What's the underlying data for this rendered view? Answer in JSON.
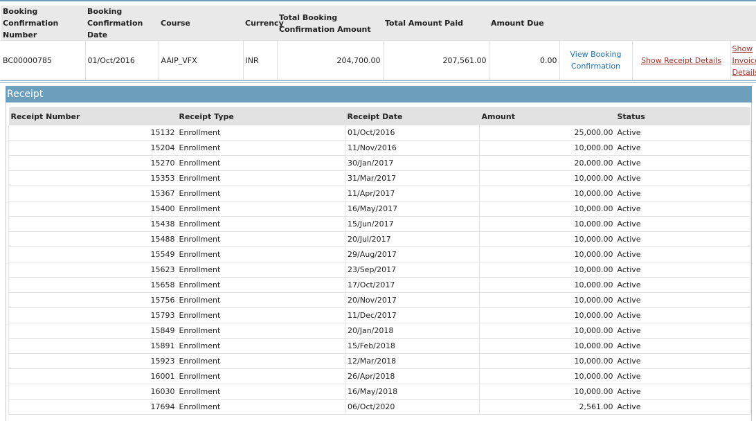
{
  "booking": {
    "headers": {
      "number": "Booking Confirmation Number",
      "date": "Booking Confirmation Date",
      "course": "Course",
      "currency": "Currency",
      "total": "Total Booking Confirmation Amount",
      "paid": "Total Amount Paid",
      "due": "Amount Due"
    },
    "row": {
      "number": "BC00000785",
      "date": "01/Oct/2016",
      "course": "AAIP_VFX",
      "currency": "INR",
      "total": "204,700.00",
      "paid": "207,561.00",
      "due": "0.00",
      "view_link": "View Booking Confirmation",
      "receipt_link": "Show Receipt Details",
      "invoice_link": "Show Invoice Details"
    }
  },
  "receipt_panel": {
    "title": "Receipt",
    "headers": {
      "number": "Receipt Number",
      "type": "Receipt Type",
      "date": "Receipt Date",
      "amount": "Amount",
      "status": "Status"
    },
    "rows": [
      {
        "number": "15132",
        "type": "Enrollment",
        "date": "01/Oct/2016",
        "amount": "25,000.00",
        "status": "Active"
      },
      {
        "number": "15204",
        "type": "Enrollment",
        "date": "11/Nov/2016",
        "amount": "10,000.00",
        "status": "Active"
      },
      {
        "number": "15270",
        "type": "Enrollment",
        "date": "30/Jan/2017",
        "amount": "20,000.00",
        "status": "Active"
      },
      {
        "number": "15353",
        "type": "Enrollment",
        "date": "31/Mar/2017",
        "amount": "10,000.00",
        "status": "Active"
      },
      {
        "number": "15367",
        "type": "Enrollment",
        "date": "11/Apr/2017",
        "amount": "10,000.00",
        "status": "Active"
      },
      {
        "number": "15400",
        "type": "Enrollment",
        "date": "16/May/2017",
        "amount": "10,000.00",
        "status": "Active"
      },
      {
        "number": "15438",
        "type": "Enrollment",
        "date": "15/Jun/2017",
        "amount": "10,000.00",
        "status": "Active"
      },
      {
        "number": "15488",
        "type": "Enrollment",
        "date": "20/Jul/2017",
        "amount": "10,000.00",
        "status": "Active"
      },
      {
        "number": "15549",
        "type": "Enrollment",
        "date": "29/Aug/2017",
        "amount": "10,000.00",
        "status": "Active"
      },
      {
        "number": "15623",
        "type": "Enrollment",
        "date": "23/Sep/2017",
        "amount": "10,000.00",
        "status": "Active"
      },
      {
        "number": "15658",
        "type": "Enrollment",
        "date": "17/Oct/2017",
        "amount": "10,000.00",
        "status": "Active"
      },
      {
        "number": "15756",
        "type": "Enrollment",
        "date": "20/Nov/2017",
        "amount": "10,000.00",
        "status": "Active"
      },
      {
        "number": "15793",
        "type": "Enrollment",
        "date": "11/Dec/2017",
        "amount": "10,000.00",
        "status": "Active"
      },
      {
        "number": "15849",
        "type": "Enrollment",
        "date": "20/Jan/2018",
        "amount": "10,000.00",
        "status": "Active"
      },
      {
        "number": "15891",
        "type": "Enrollment",
        "date": "15/Feb/2018",
        "amount": "10,000.00",
        "status": "Active"
      },
      {
        "number": "15923",
        "type": "Enrollment",
        "date": "12/Mar/2018",
        "amount": "10,000.00",
        "status": "Active"
      },
      {
        "number": "16001",
        "type": "Enrollment",
        "date": "26/Apr/2018",
        "amount": "10,000.00",
        "status": "Active"
      },
      {
        "number": "16030",
        "type": "Enrollment",
        "date": "16/May/2018",
        "amount": "10,000.00",
        "status": "Active"
      },
      {
        "number": "17694",
        "type": "Enrollment",
        "date": "06/Oct/2020",
        "amount": "2,561.00",
        "status": "Active"
      }
    ]
  }
}
